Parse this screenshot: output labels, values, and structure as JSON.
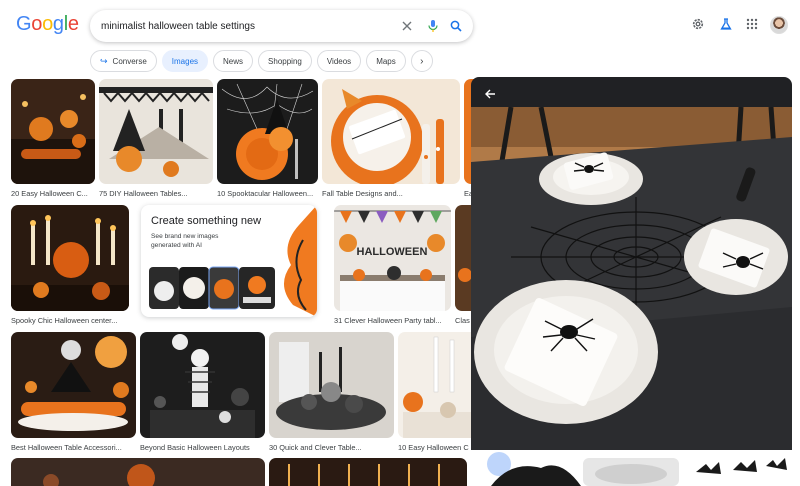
{
  "logo": {
    "letters": [
      "G",
      "o",
      "o",
      "g",
      "l",
      "e"
    ],
    "colors": [
      "#4285F4",
      "#EA4335",
      "#FBBC05",
      "#4285F4",
      "#34A853",
      "#EA4335"
    ]
  },
  "search": {
    "query": "minimalist halloween table settings",
    "icons": [
      "close-icon",
      "microphone-icon",
      "search-icon"
    ]
  },
  "header_icons": [
    "gear-icon",
    "labs-flask-icon",
    "apps-grid-icon"
  ],
  "chips": [
    {
      "label": "Converse",
      "icon": "converse-arrow-icon",
      "active": false
    },
    {
      "label": "Images",
      "active": true
    },
    {
      "label": "News",
      "active": false
    },
    {
      "label": "Shopping",
      "active": false
    },
    {
      "label": "Videos",
      "active": false
    },
    {
      "label": "Maps",
      "active": false
    }
  ],
  "results": {
    "row1": [
      {
        "title": "20 Easy Halloween C..."
      },
      {
        "title": "75 DIY Halloween Tables..."
      },
      {
        "title": "10 Spooktacular Halloween..."
      },
      {
        "title": "Fall Table Designs and..."
      },
      {
        "title": "Ea"
      }
    ],
    "row2": [
      {
        "title": "Spooky Chic Halloween center..."
      },
      {
        "title": "31 Clever Halloween Party tabl..."
      },
      {
        "title": "Clas"
      }
    ],
    "row3": [
      {
        "title": "Best Halloween Table Accessori..."
      },
      {
        "title": "Beyond Basic Halloween Layouts"
      },
      {
        "title": "30 Quick and Clever Table..."
      },
      {
        "title": "10 Easy Halloween C"
      }
    ]
  },
  "banner_text": "HALLOWEEN",
  "create_card": {
    "title": "Create something new",
    "subtitle": "See brand new images generated with AI"
  },
  "accent": "#1a73e8",
  "panel": {
    "back_icon": "arrow-back-icon"
  }
}
